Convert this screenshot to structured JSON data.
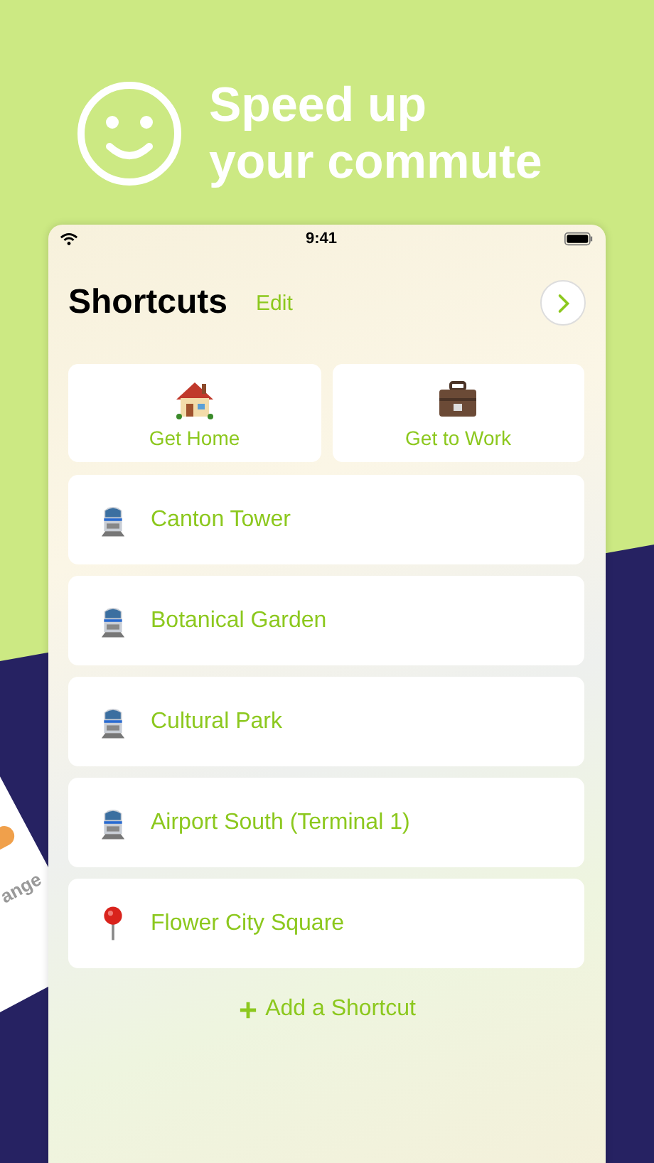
{
  "headline": {
    "lines": [
      "Speed up",
      "your commute"
    ]
  },
  "background_card": {
    "text": "ange"
  },
  "status_bar": {
    "time": "9:41"
  },
  "nav": {
    "title": "Shortcuts",
    "edit": "Edit"
  },
  "quick_tiles": [
    {
      "label": "Get Home",
      "kind": "home"
    },
    {
      "label": "Get to Work",
      "kind": "work"
    }
  ],
  "shortcuts": [
    {
      "label": "Canton Tower",
      "kind": "train"
    },
    {
      "label": "Botanical Garden",
      "kind": "train"
    },
    {
      "label": "Cultural Park",
      "kind": "train"
    },
    {
      "label": "Airport South (Terminal 1)",
      "kind": "train"
    },
    {
      "label": "Flower City Square",
      "kind": "pin"
    }
  ],
  "add_button": {
    "label": "Add a Shortcut"
  }
}
